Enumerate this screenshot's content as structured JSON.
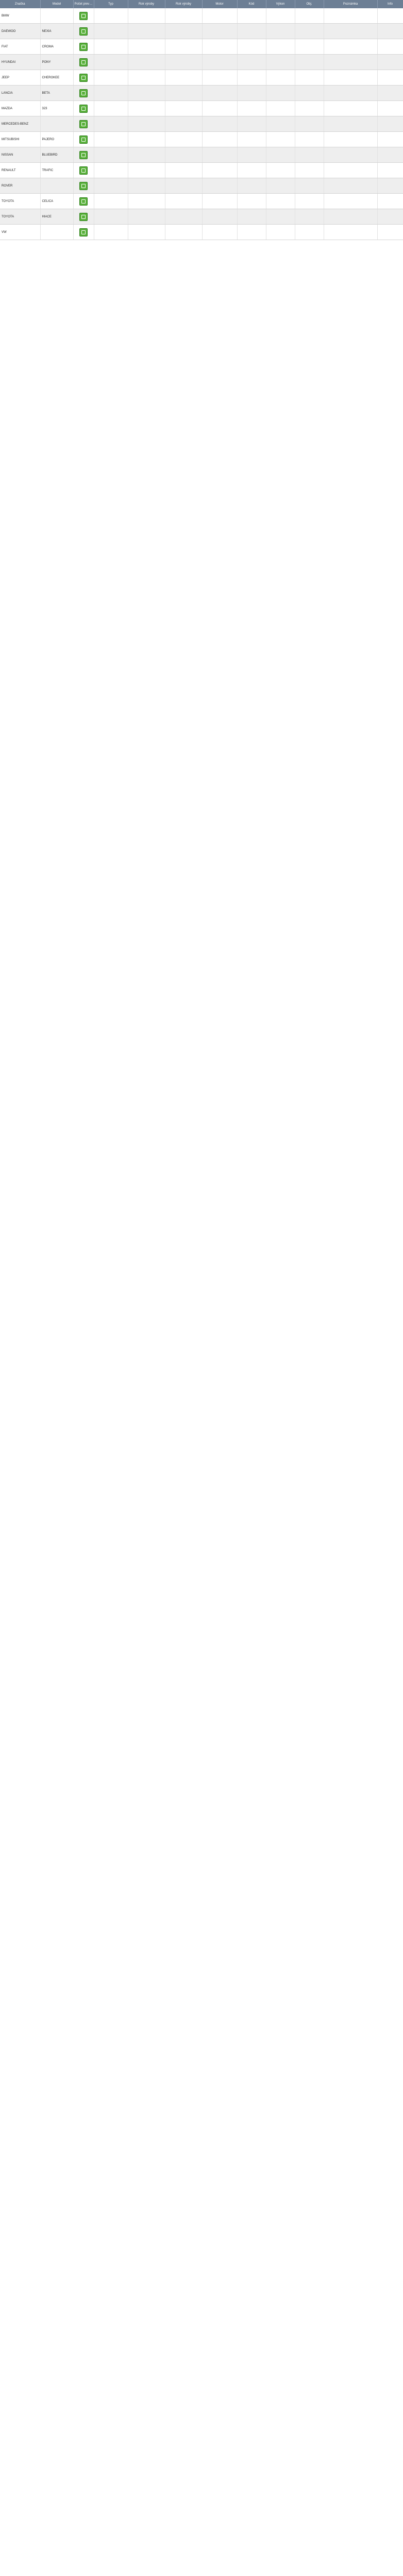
{
  "table": {
    "headers": [
      "Značka",
      "Model",
      "Počet prevodov",
      "Typ",
      "Rok výroby",
      "Rok výroby",
      "Motor",
      "Kód",
      "Výkon",
      "Obj.",
      "Poznámka",
      "Info"
    ],
    "rows": [
      [
        "BMW",
        "",
        "",
        "",
        "",
        "",
        "",
        "",
        "",
        "",
        "",
        ""
      ],
      [
        "DAEWOO",
        "NEXIA",
        "",
        "",
        "",
        "",
        "",
        "",
        "",
        "",
        "",
        ""
      ],
      [
        "FIAT",
        "CROMA",
        "",
        "",
        "",
        "",
        "",
        "",
        "",
        "",
        "",
        ""
      ],
      [
        "HYUNDAI",
        "PONY",
        "",
        "",
        "",
        "",
        "",
        "",
        "",
        "",
        "",
        ""
      ],
      [
        "JEEP",
        "CHEROKEE",
        "",
        "",
        "",
        "",
        "",
        "",
        "",
        "",
        "",
        ""
      ],
      [
        "LANCIA",
        "BETA",
        "",
        "",
        "",
        "",
        "",
        "",
        "",
        "",
        "",
        ""
      ],
      [
        "MAZDA",
        "323",
        "",
        "",
        "",
        "",
        "",
        "",
        "",
        "",
        "",
        ""
      ],
      [
        "MERCEDES-BENZ",
        "",
        "",
        "",
        "",
        "",
        "",
        "",
        "",
        "",
        "",
        ""
      ],
      [
        "MITSUBISHI",
        "PAJERO",
        "",
        "",
        "",
        "",
        "",
        "",
        "",
        "",
        "",
        ""
      ],
      [
        "NISSAN",
        "BLUEBIRD",
        "",
        "",
        "",
        "",
        "",
        "",
        "",
        "",
        "",
        ""
      ],
      [
        "RENAULT",
        "TRAFIC",
        "",
        "",
        "",
        "",
        "",
        "",
        "",
        "",
        "",
        ""
      ],
      [
        "ROVER",
        "",
        "",
        "",
        "",
        "",
        "",
        "",
        "",
        "",
        "",
        ""
      ],
      [
        "TOYOTA",
        "CELICA",
        "",
        "",
        "",
        "",
        "",
        "",
        "",
        "",
        "",
        ""
      ],
      [
        "TOYOTA",
        "HIACE",
        "",
        "",
        "",
        "",
        "",
        "",
        "",
        "",
        "",
        ""
      ],
      [
        "VW",
        "",
        "",
        "",
        "",
        "",
        "",
        "",
        "",
        "",
        "",
        ""
      ]
    ]
  },
  "icons": {
    "row_icon": "gearbox-icon",
    "row_icon_color": "#58b03a"
  },
  "colors": {
    "header_bg": "#6d7f95",
    "row_alt_bg": "#eeeeee"
  }
}
